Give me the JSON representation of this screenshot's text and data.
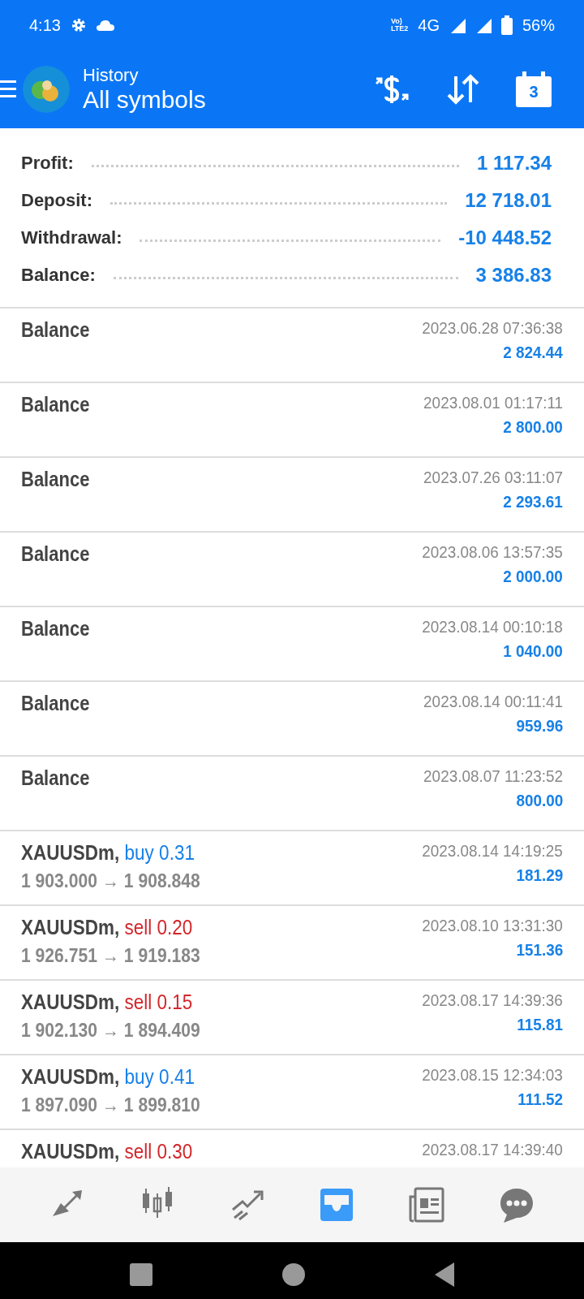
{
  "status_bar": {
    "time": "4:13",
    "volte_top": "Vo)",
    "volte_bottom": "LTE2",
    "network": "4G",
    "battery": "56%"
  },
  "header": {
    "title": "History",
    "subtitle": "All symbols",
    "calendar_day": "3"
  },
  "summary": [
    {
      "label": "Profit:",
      "value": "1 117.34"
    },
    {
      "label": "Deposit:",
      "value": "12 718.01"
    },
    {
      "label": "Withdrawal:",
      "value": "-10 448.52"
    },
    {
      "label": "Balance:",
      "value": "3 386.83"
    }
  ],
  "rows": [
    {
      "kind": "balance",
      "title": "Balance",
      "time": "2023.06.28 07:36:38",
      "amount": "2 824.44"
    },
    {
      "kind": "balance",
      "title": "Balance",
      "time": "2023.08.01 01:17:11",
      "amount": "2 800.00"
    },
    {
      "kind": "balance",
      "title": "Balance",
      "time": "2023.07.26 03:11:07",
      "amount": "2 293.61"
    },
    {
      "kind": "balance",
      "title": "Balance",
      "time": "2023.08.06 13:57:35",
      "amount": "2 000.00"
    },
    {
      "kind": "balance",
      "title": "Balance",
      "time": "2023.08.14 00:10:18",
      "amount": "1 040.00"
    },
    {
      "kind": "balance",
      "title": "Balance",
      "time": "2023.08.14 00:11:41",
      "amount": "959.96"
    },
    {
      "kind": "balance",
      "title": "Balance",
      "time": "2023.08.07 11:23:52",
      "amount": "800.00"
    },
    {
      "kind": "trade",
      "symbol": "XAUUSDm,",
      "side": "buy",
      "volume": "0.31",
      "prices": "1 903.000 → 1 908.848",
      "time": "2023.08.14 14:19:25",
      "amount": "181.29"
    },
    {
      "kind": "trade",
      "symbol": "XAUUSDm,",
      "side": "sell",
      "volume": "0.20",
      "prices": "1 926.751 → 1 919.183",
      "time": "2023.08.10 13:31:30",
      "amount": "151.36"
    },
    {
      "kind": "trade",
      "symbol": "XAUUSDm,",
      "side": "sell",
      "volume": "0.15",
      "prices": "1 902.130 → 1 894.409",
      "time": "2023.08.17 14:39:36",
      "amount": "115.81"
    },
    {
      "kind": "trade",
      "symbol": "XAUUSDm,",
      "side": "buy",
      "volume": "0.41",
      "prices": "1 897.090 → 1 899.810",
      "time": "2023.08.15 12:34:03",
      "amount": "111.52"
    },
    {
      "kind": "trade",
      "symbol": "XAUUSDm,",
      "side": "sell",
      "volume": "0.30",
      "time": "2023.08.17 14:39:40"
    }
  ],
  "bottom_nav": [
    {
      "selected": false
    },
    {
      "selected": false
    },
    {
      "selected": false
    },
    {
      "selected": true
    },
    {
      "selected": false
    },
    {
      "selected": false
    }
  ]
}
